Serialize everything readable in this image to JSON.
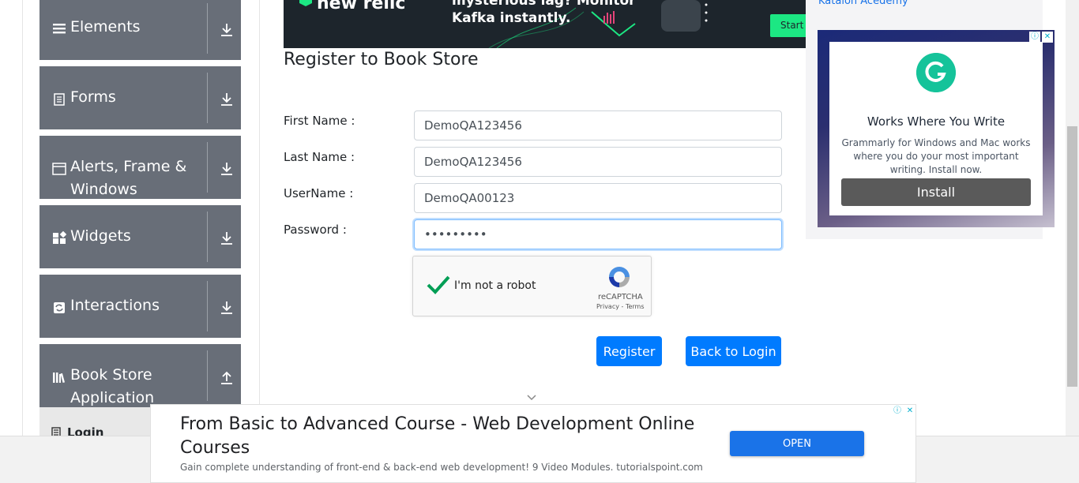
{
  "sidebar": {
    "groups": [
      {
        "label": "Elements",
        "icon": "menu-icon",
        "arrow": "download-arrow-icon"
      },
      {
        "label": "Forms",
        "icon": "document-icon",
        "arrow": "download-arrow-icon"
      },
      {
        "label": "Alerts, Frame & Windows",
        "icon": "window-icon",
        "arrow": "download-arrow-icon"
      },
      {
        "label": "Widgets",
        "icon": "widgets-icon",
        "arrow": "download-arrow-icon"
      },
      {
        "label": "Interactions",
        "icon": "interactions-icon",
        "arrow": "download-arrow-icon"
      },
      {
        "label": "Book Store Application",
        "icon": "books-icon",
        "arrow": "upload-arrow-icon"
      }
    ],
    "active_item": {
      "label": "Login",
      "icon": "login-icon"
    }
  },
  "top_banner": {
    "brand": "new relic",
    "text_line1": "mysterious lag? Monitor",
    "text_line2": "Kafka instantly.",
    "cta": "Start f"
  },
  "form": {
    "heading": "Register to Book Store",
    "first_name": {
      "label": "First Name :",
      "value": "DemoQA123456"
    },
    "last_name": {
      "label": "Last Name :",
      "value": "DemoQA123456"
    },
    "username": {
      "label": "UserName :",
      "value": "DemoQA00123"
    },
    "password": {
      "label": "Password :",
      "value": "•••••••••"
    },
    "captcha": {
      "label": "I'm not a robot",
      "brand": "reCAPTCHA",
      "links": "Privacy - Terms",
      "checked": true
    },
    "register_label": "Register",
    "back_label": "Back to Login"
  },
  "right_ad": {
    "link_text": "Katalon Acedemy",
    "title": "Works Where You Write",
    "body": "Grammarly for Windows and Mac works where you do your most important writing. Install now.",
    "button": "Install"
  },
  "bottom_ad": {
    "title": "From Basic to Advanced Course - Web Development Online Courses",
    "subtitle": "Gain complete understanding of front-end & back-end web development! 9 Video Modules. tutorialspoint.com",
    "button": "OPEN"
  },
  "colors": {
    "sidebar_group": "#686e78",
    "primary_button": "#007bff",
    "ad_button": "#1a73e8",
    "grammarly_green": "#15c39a"
  }
}
